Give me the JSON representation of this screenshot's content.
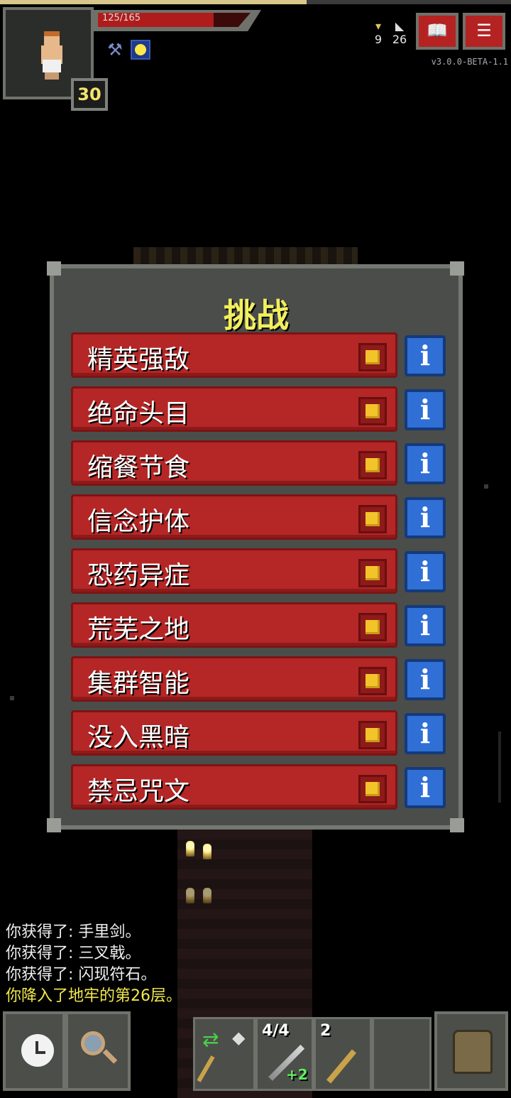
{
  "hud": {
    "hp_text": "125/165",
    "hp_fraction": 0.758,
    "xp_fraction": 0.6,
    "level": "30",
    "gold": "9",
    "depth": "26",
    "version": "v3.0.0-BETA-1.1",
    "journal_icon": "journal-icon",
    "menu_icon": "menu-icon"
  },
  "challenges": {
    "title": "挑战",
    "items": [
      {
        "label": "精英强敌"
      },
      {
        "label": "绝命头目"
      },
      {
        "label": "缩餐节食"
      },
      {
        "label": "信念护体"
      },
      {
        "label": "恐药异症"
      },
      {
        "label": "荒芜之地"
      },
      {
        "label": "集群智能"
      },
      {
        "label": "没入黑暗"
      },
      {
        "label": "禁忌咒文"
      }
    ],
    "info_symbol": "i"
  },
  "log": {
    "lines": [
      "你获得了: 手里剑。",
      "你获得了: 三叉戟。",
      "你获得了: 闪现符石。",
      "你降入了地牢的第26层。"
    ]
  },
  "toolbar": {
    "slot1_count": "4/4",
    "slot1_bonus": "+2",
    "slot2_count": "2"
  },
  "colors": {
    "challenge_bg": "#b52626",
    "info_bg": "#2f6fd6",
    "title": "#f2ef5e",
    "log_highlight": "#f2e94e"
  }
}
